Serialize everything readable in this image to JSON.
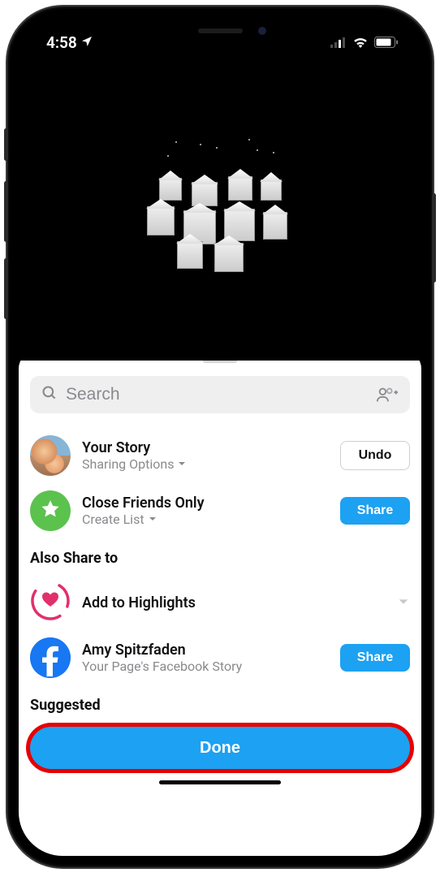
{
  "status": {
    "time": "4:58",
    "location_icon": "location-arrow",
    "signal_icon": "cellular-signal",
    "wifi_icon": "wifi",
    "battery_icon": "battery"
  },
  "search": {
    "placeholder": "Search",
    "icon": "search-icon",
    "add_people_icon": "group-add-icon"
  },
  "rows": {
    "your_story": {
      "title": "Your Story",
      "subtitle": "Sharing Options",
      "action": "Undo"
    },
    "close_friends": {
      "title": "Close Friends Only",
      "subtitle": "Create List",
      "action": "Share",
      "icon": "star-icon"
    }
  },
  "also_share": {
    "header": "Also Share to",
    "highlights": {
      "title": "Add to Highlights",
      "icon": "heart-icon"
    },
    "facebook": {
      "title": "Amy Spitzfaden",
      "subtitle": "Your Page's Facebook Story",
      "action": "Share",
      "icon": "facebook-icon"
    }
  },
  "suggested": {
    "header": "Suggested"
  },
  "done": {
    "label": "Done"
  }
}
